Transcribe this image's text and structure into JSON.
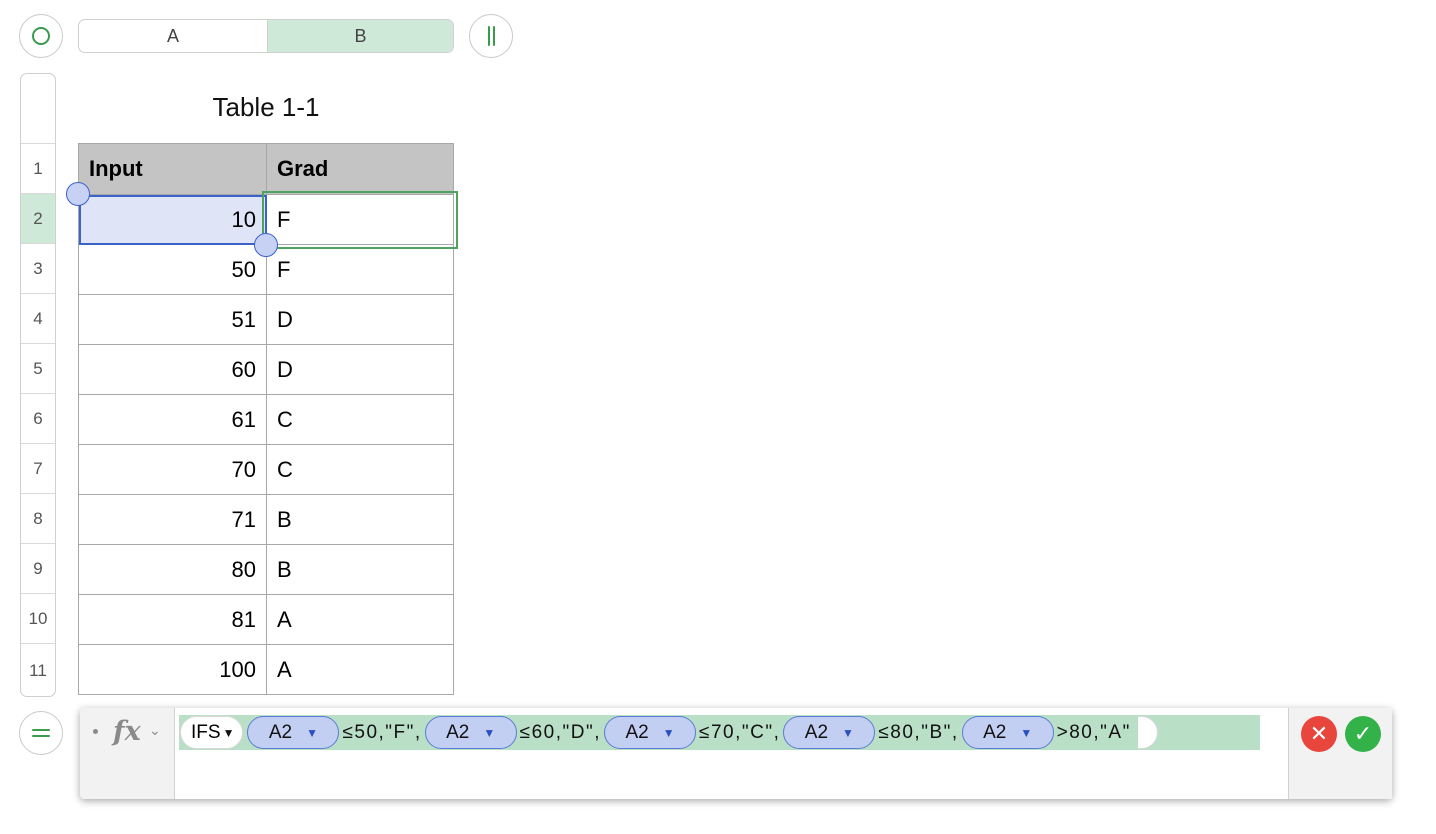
{
  "column_headers": [
    "A",
    "B"
  ],
  "row_numbers": [
    "1",
    "2",
    "3",
    "4",
    "5",
    "6",
    "7",
    "8",
    "9",
    "10",
    "11"
  ],
  "table": {
    "title": "Table 1-1",
    "headers": [
      "Input",
      "Grad"
    ],
    "rows": [
      [
        "10",
        "F"
      ],
      [
        "50",
        "F"
      ],
      [
        "51",
        "D"
      ],
      [
        "60",
        "D"
      ],
      [
        "61",
        "C"
      ],
      [
        "70",
        "C"
      ],
      [
        "71",
        "B"
      ],
      [
        "80",
        "B"
      ],
      [
        "81",
        "A"
      ],
      [
        "100",
        "A"
      ]
    ]
  },
  "formula_bar": {
    "fx_label": "fx",
    "function_name": "IFS",
    "references": [
      "A2",
      "A2",
      "A2",
      "A2",
      "A2"
    ],
    "segments": [
      "≤50,\"F\",",
      "≤60,\"D\",",
      "≤70,\"C\",",
      "≤80,\"B\",",
      ">80,\"A\""
    ]
  },
  "colors": {
    "selection_green": "#cfe9d8",
    "formula_green": "#b9dfc6",
    "reference_blue": "#c3cff2",
    "accept_green": "#33b24a",
    "cancel_red": "#e8453c"
  },
  "icons": [
    "add-table-circle-icon",
    "freeze-columns-icon",
    "formula-equals-icon",
    "function-fx-icon",
    "chevron-down-icon",
    "cancel-x-icon",
    "accept-check-icon"
  ]
}
